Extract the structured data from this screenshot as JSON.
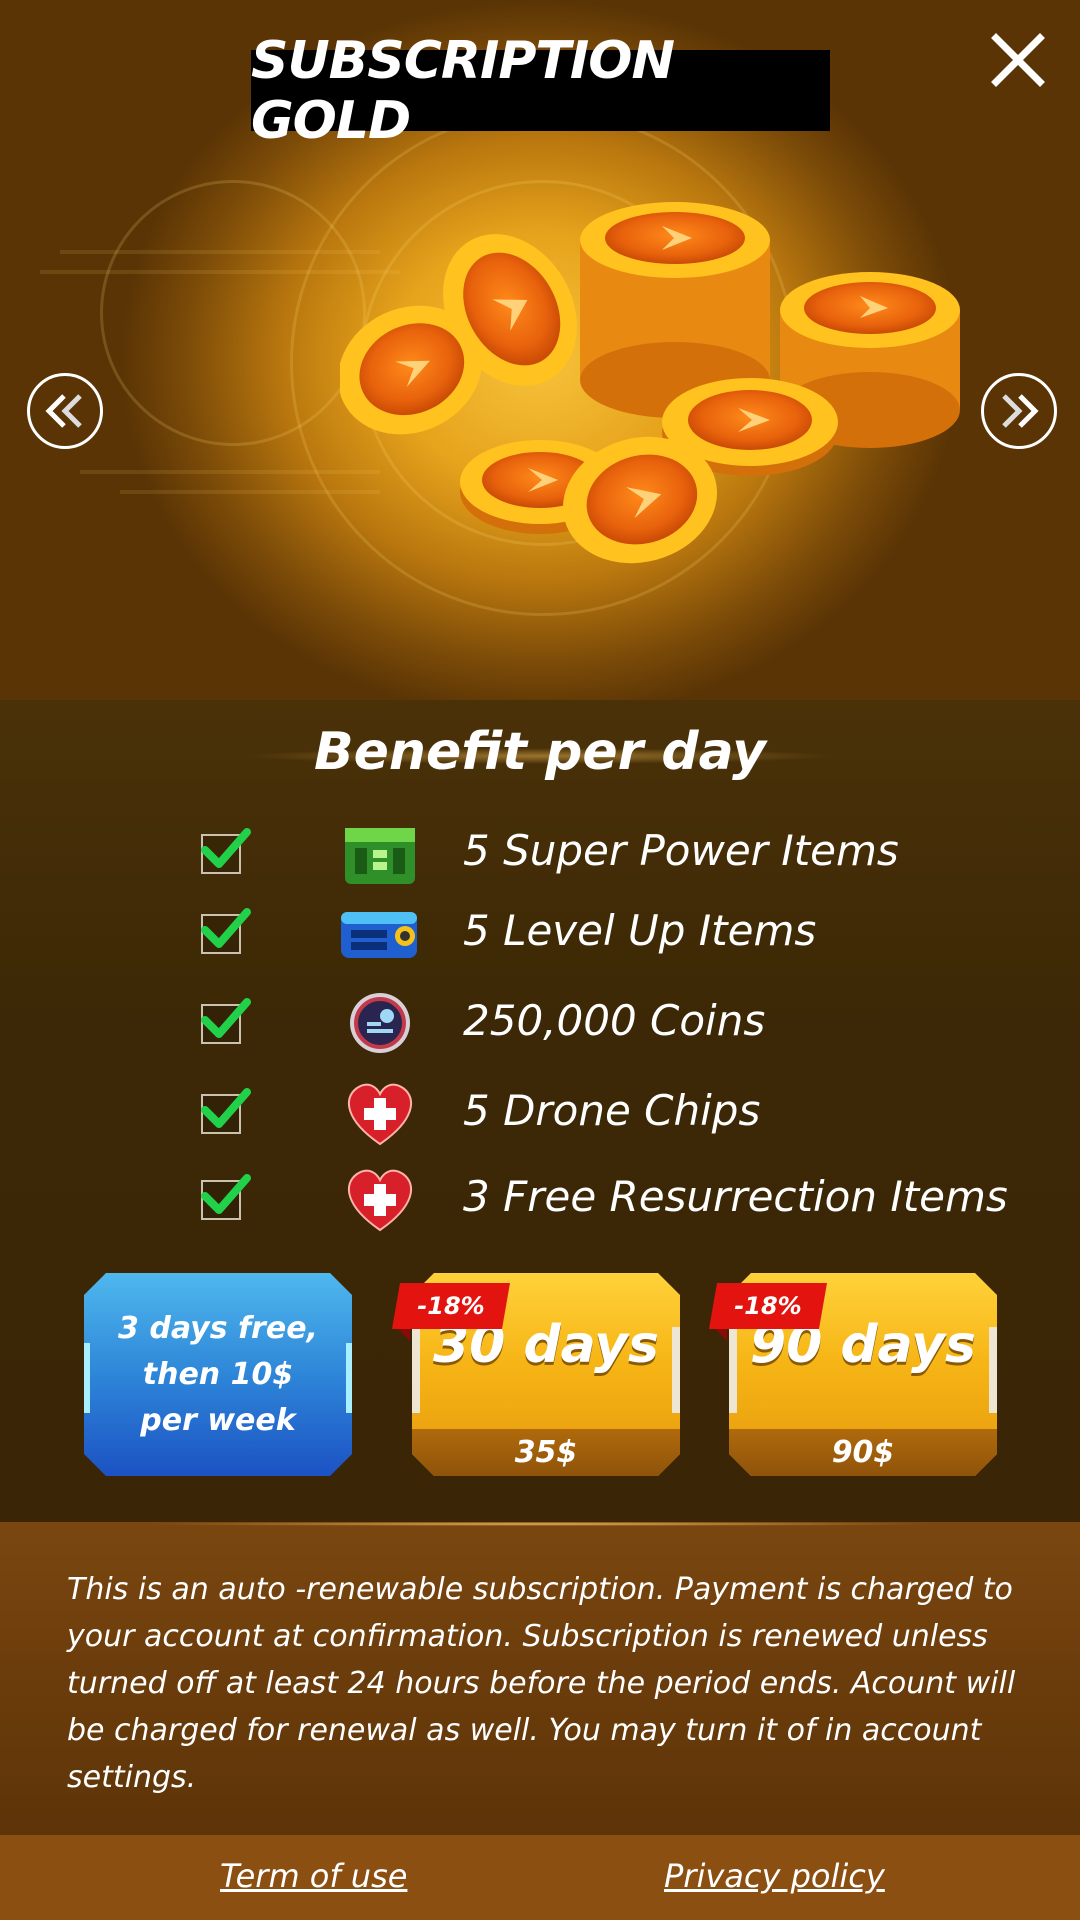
{
  "header": {
    "title": "SUBSCRIPTION GOLD",
    "close_icon": "close-icon",
    "prev_icon": "chevron-double-left-icon",
    "next_icon": "chevron-double-right-icon"
  },
  "benefits": {
    "title": "Benefit per day",
    "items": [
      {
        "label": "5 Super Power Items",
        "icon": "green-crate-icon",
        "checked": true
      },
      {
        "label": "5 Level Up Items",
        "icon": "blue-case-icon",
        "checked": true
      },
      {
        "label": "250,000 Coins",
        "icon": "coin-emblem-icon",
        "checked": true
      },
      {
        "label": "5 Drone Chips",
        "icon": "heart-plus-icon",
        "checked": true
      },
      {
        "label": "3 Free Resurrection Items",
        "icon": "heart-plus-icon",
        "checked": true
      }
    ]
  },
  "plans": {
    "trial": {
      "line1": "3 days free,",
      "line2": "then 10$",
      "line3": "per week"
    },
    "monthly": {
      "days": "30 days",
      "price": "35$",
      "discount": "-18%"
    },
    "quarterly": {
      "days": "90 days",
      "price": "90$",
      "discount": "-18%"
    }
  },
  "legal": {
    "text": "This is an auto -renewable subscription. Payment is charged to your account at confirmation. Subscription is renewed unless turned off at least 24 hours before the period ends. Acount will be charged for renewal as well. You may turn it of in account settings."
  },
  "footer": {
    "terms_label": "Term of use",
    "privacy_label": "Privacy policy"
  },
  "colors": {
    "gold_card": "#f6b415",
    "trial_card": "#2e86d8",
    "discount_badge": "#e3140f",
    "check_green": "#22d14a",
    "footer_bar": "#8c4f12"
  }
}
